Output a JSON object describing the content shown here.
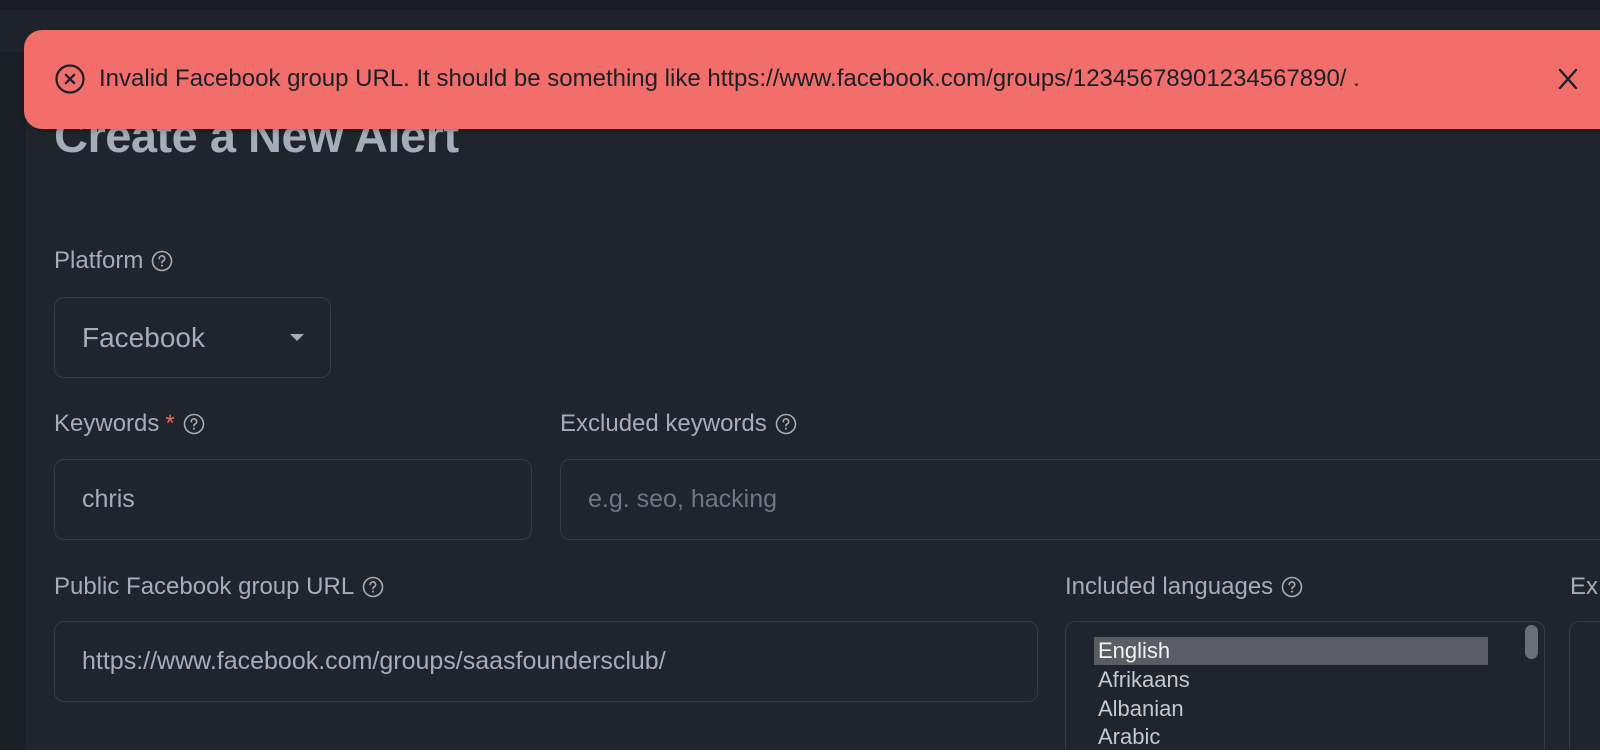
{
  "page": {
    "title": "Create a New Alert"
  },
  "alert": {
    "message": "Invalid Facebook group URL. It should be something like https://www.facebook.com/groups/12345678901234567890/ .",
    "icon": "error-circle-x-icon",
    "close_icon": "close-icon",
    "color": "#f16e6b"
  },
  "form": {
    "platform": {
      "label": "Platform",
      "value": "Facebook"
    },
    "keywords": {
      "label": "Keywords",
      "required_mark": "*",
      "value": "chris"
    },
    "excluded_keywords": {
      "label": "Excluded keywords",
      "placeholder": "e.g. seo, hacking"
    },
    "group_url": {
      "label": "Public Facebook group URL",
      "value": "https://www.facebook.com/groups/saasfoundersclub/"
    },
    "included_languages": {
      "label": "Included languages",
      "options": [
        "English",
        "Afrikaans",
        "Albanian",
        "Arabic"
      ],
      "selected": "English"
    },
    "excluded_languages": {
      "label": "Ex"
    }
  },
  "colors": {
    "background": "#20242c",
    "text": "#a6adba",
    "required": "#e86a5c"
  }
}
